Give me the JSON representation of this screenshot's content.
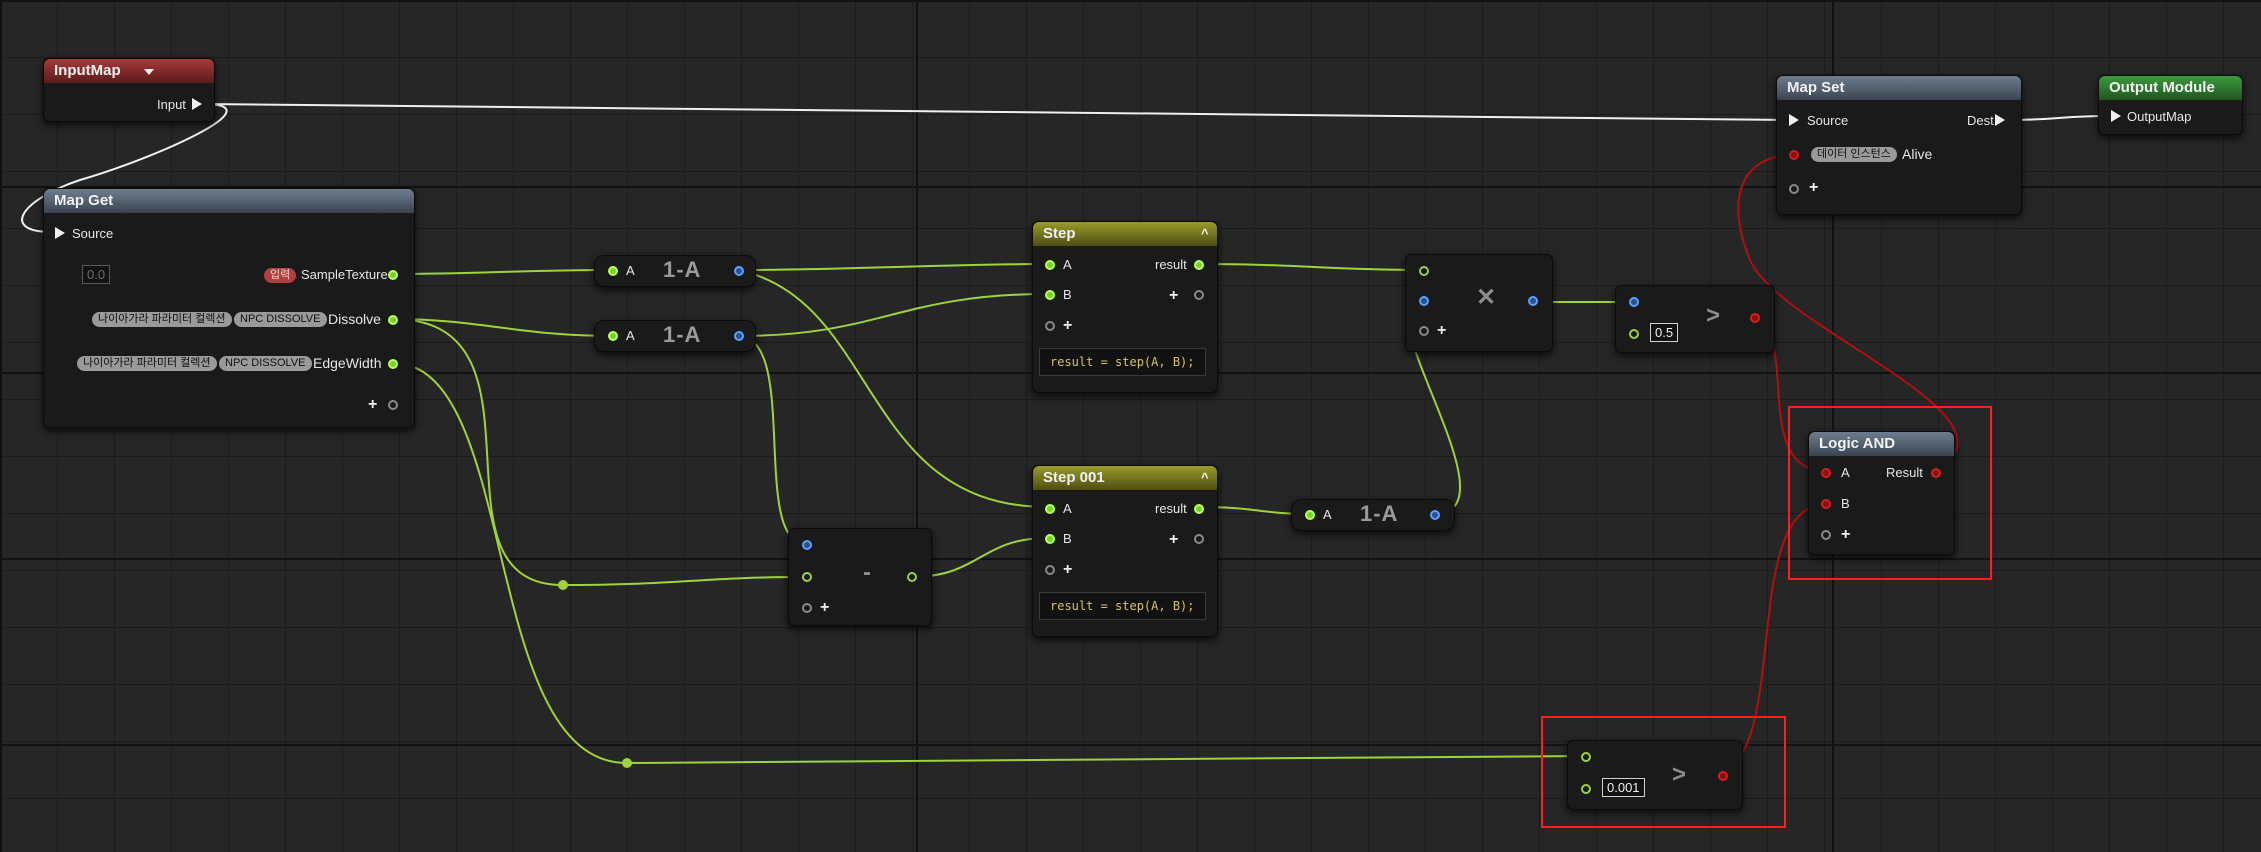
{
  "nodes": {
    "input_map": {
      "title": "InputMap",
      "output_label": "Input"
    },
    "map_get": {
      "title": "Map Get",
      "source_label": "Source",
      "key_value": "0.0",
      "rows": [
        {
          "badges": [
            "입력"
          ],
          "label": "SampleTexture"
        },
        {
          "badges": [
            "나이아가라 파라미터 컬렉션",
            "NPC DISSOLVE"
          ],
          "label": "Dissolve"
        },
        {
          "badges": [
            "나이아가라 파라미터 컬렉션",
            "NPC DISSOLVE"
          ],
          "label": "EdgeWidth"
        }
      ]
    },
    "one_minus_1": {
      "op": "1-A",
      "input_label": "A"
    },
    "one_minus_2": {
      "op": "1-A",
      "input_label": "A"
    },
    "one_minus_3": {
      "op": "1-A",
      "input_label": "A"
    },
    "step": {
      "title": "Step",
      "a": "A",
      "b": "B",
      "result": "result",
      "code": "result = step(A, B);"
    },
    "step_001": {
      "title": "Step 001",
      "a": "A",
      "b": "B",
      "result": "result",
      "code": "result = step(A, B);"
    },
    "subtract": {
      "op": "-"
    },
    "multiply": {
      "op": "✕"
    },
    "greater_1": {
      "op": ">",
      "value": "0.5"
    },
    "greater_2": {
      "op": ">",
      "value": "0.001"
    },
    "map_set": {
      "title": "Map Set",
      "source_label": "Source",
      "dest_label": "Dest",
      "badge": "데이터 인스턴스",
      "key_label": "Alive"
    },
    "output_module": {
      "title": "Output Module",
      "input_label": "OutputMap"
    },
    "logic_and": {
      "title": "Logic AND",
      "a": "A",
      "b": "B",
      "result": "Result"
    }
  },
  "colors": {
    "float_wire": "#9fd33b",
    "bool_wire": "#b01010",
    "exec_wire": "#f0f0f0",
    "highlight": "#ff1e1e"
  }
}
